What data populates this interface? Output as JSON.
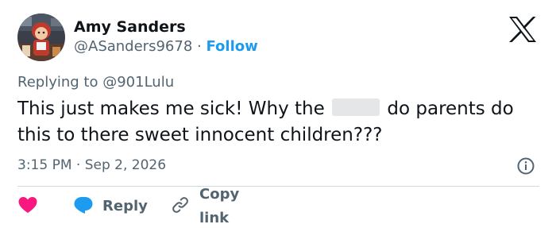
{
  "author": {
    "name": "Amy Sanders",
    "handle": "@ASanders9678",
    "separator": "·",
    "follow_label": "Follow"
  },
  "reply_context": {
    "prefix": "Replying to",
    "mention": "@901Lulu"
  },
  "tweet": {
    "text_before": "This just makes me sick!  Why the",
    "text_after": "do parents do this to there sweet innocent children???"
  },
  "meta": {
    "time": "3:15 PM",
    "separator": "·",
    "date": "Sep 2, 2026"
  },
  "actions": {
    "reply_label": "Reply",
    "copy_label": "Copy link"
  },
  "colors": {
    "like_heart": "#f91880",
    "reply_bubble": "#1d9bf0",
    "link": "#1d9bf0",
    "secondary_text": "#536471"
  },
  "icons": {
    "logo": "x-logo-icon",
    "info": "info-icon",
    "like": "heart-icon",
    "reply": "speech-bubble-icon",
    "copy": "link-icon"
  }
}
